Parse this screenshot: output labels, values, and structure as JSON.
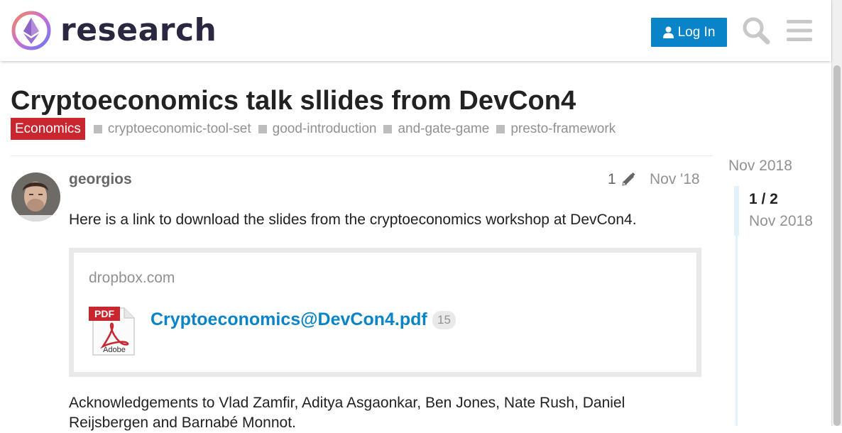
{
  "header": {
    "site_name": "research",
    "login_label": "Log In"
  },
  "topic": {
    "title": "Cryptoeconomics talk sllides from DevCon4",
    "category": "Economics",
    "category_color": "#c9262f",
    "tags": [
      "cryptoeconomic-tool-set",
      "good-introduction",
      "and-gate-game",
      "presto-framework"
    ]
  },
  "post": {
    "username": "georgios",
    "edit_count": "1",
    "date": "Nov '18",
    "text": "Here is a link to download the slides from the cryptoeconomics workshop at DevCon4.",
    "onebox": {
      "source": "dropbox.com",
      "file_name": "Cryptoeconomics@DevCon4.pdf",
      "click_count": "15",
      "pdf_label": "PDF",
      "pdf_brand": "Adobe"
    },
    "acknowledgements": "Acknowledgements to Vlad Zamfir, Aditya Asgaonkar, Ben Jones, Nate Rush, Daniel Reijsbergen and Barnabé Monnot."
  },
  "timeline": {
    "start_date": "Nov 2018",
    "position": "1 / 2",
    "current_date": "Nov 2018"
  },
  "colors": {
    "accent": "#0a84c8",
    "text": "#222222",
    "muted": "#919191"
  }
}
